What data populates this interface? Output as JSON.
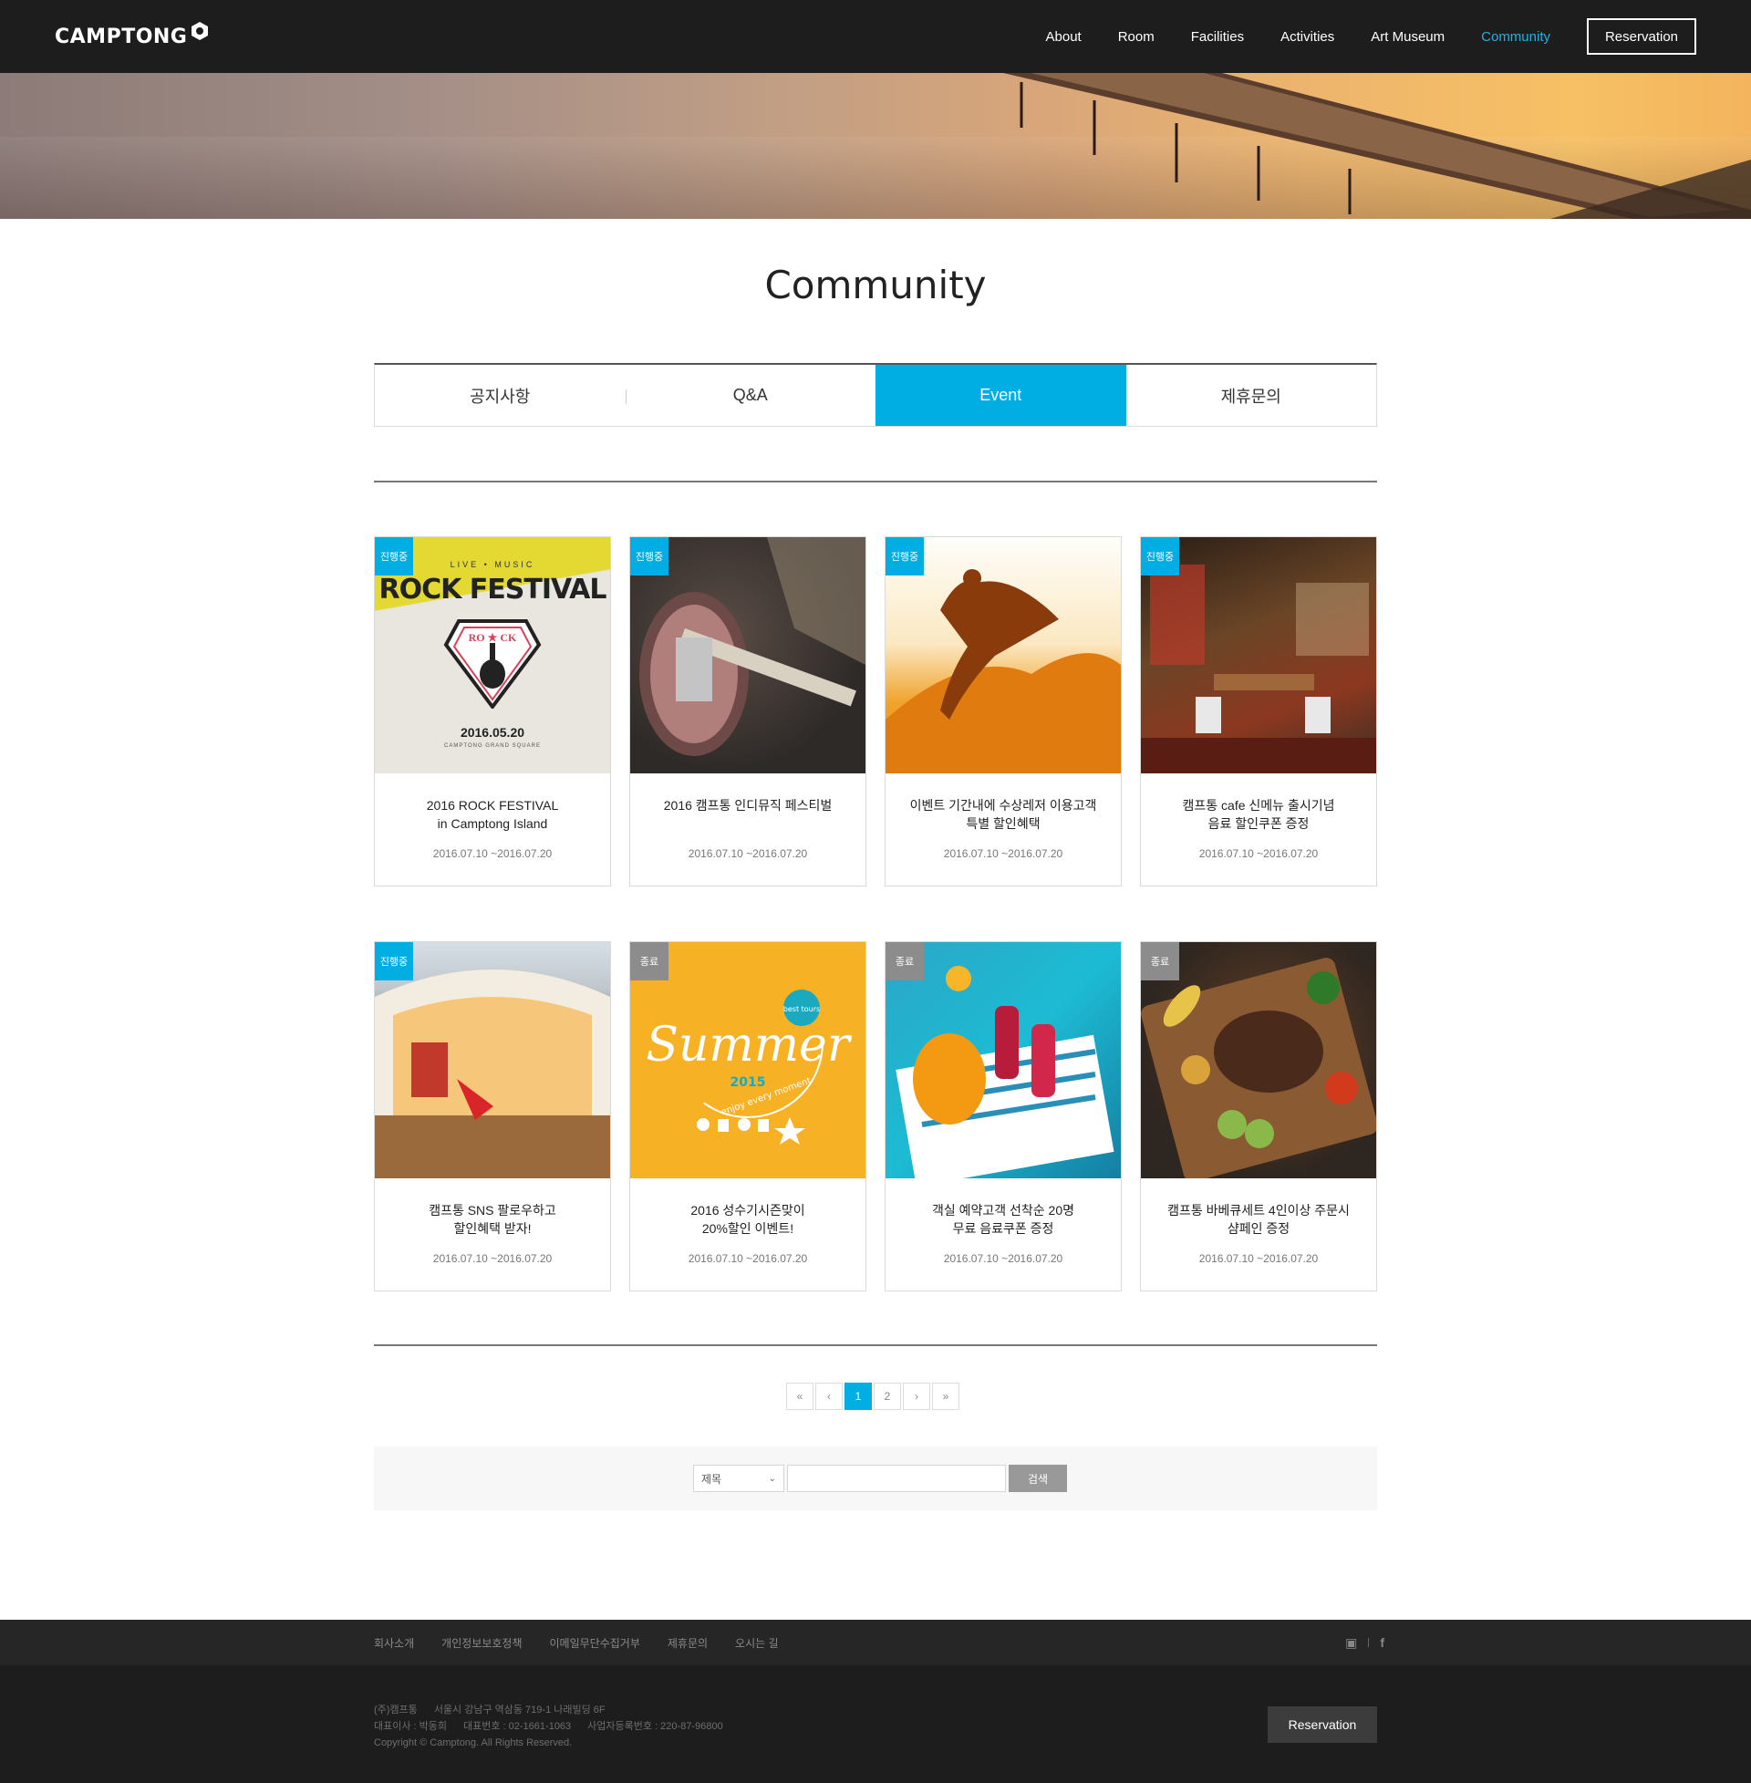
{
  "header": {
    "logo": "CAMPTONG",
    "nav": [
      "About",
      "Room",
      "Facilities",
      "Activities",
      "Art Museum",
      "Community"
    ],
    "active_nav": "Community",
    "reservation": "Reservation"
  },
  "page_title": "Community",
  "tabs": [
    "공지사항",
    "Q&A",
    "Event",
    "제휴문의"
  ],
  "active_tab": "Event",
  "poster": {
    "live": "LIVE • MUSIC",
    "headline": "ROCK FESTIVAL",
    "date": "2016.05.20",
    "place": "CAMPTONG GRAND SQUARE"
  },
  "summer_poster": {
    "word": "Summer",
    "year": "2015",
    "tagline": "enjoy every moment",
    "seal": "best tours"
  },
  "events": [
    {
      "status": "진행중",
      "state": "on",
      "title1": "2016 ROCK FESTIVAL",
      "title2": "in Camptong Island",
      "date": "2016.07.10 ~2016.07.20"
    },
    {
      "status": "진행중",
      "state": "on",
      "title1": "2016 캠프통 인디뮤직 페스티벌",
      "title2": "",
      "date": "2016.07.10 ~2016.07.20"
    },
    {
      "status": "진행중",
      "state": "on",
      "title1": "이벤트 기간내에 수상레저 이용고객",
      "title2": "특별 할인혜택",
      "date": "2016.07.10 ~2016.07.20"
    },
    {
      "status": "진행중",
      "state": "on",
      "title1": "캠프통 cafe 신메뉴 출시기념",
      "title2": "음료 할인쿠폰 증정",
      "date": "2016.07.10 ~2016.07.20"
    },
    {
      "status": "진행중",
      "state": "on",
      "title1": "캠프통 SNS 팔로우하고",
      "title2": "할인혜택 받자!",
      "date": "2016.07.10 ~2016.07.20"
    },
    {
      "status": "종료",
      "state": "off",
      "title1": "2016 성수기시즌맞이",
      "title2": "20%할인 이벤트!",
      "date": "2016.07.10 ~2016.07.20"
    },
    {
      "status": "종료",
      "state": "off",
      "title1": "객실 예약고객 선착순 20명",
      "title2": "무료 음료쿠폰 증정",
      "date": "2016.07.10 ~2016.07.20"
    },
    {
      "status": "종료",
      "state": "off",
      "title1": "캠프통 바베큐세트 4인이상 주문시",
      "title2": "샴페인 증정",
      "date": "2016.07.10 ~2016.07.20"
    }
  ],
  "pagination": {
    "pages": [
      "1",
      "2"
    ],
    "current": "1"
  },
  "search": {
    "field": "제목",
    "value": "",
    "button": "검색"
  },
  "footer": {
    "links": [
      "회사소개",
      "개인정보보호정책",
      "이메일무단수집거부",
      "제휴문의",
      "오시는 길"
    ],
    "company": "(주)캠프통",
    "address": "서울시 강남구 역삼동 719-1 나래빌딩 6F",
    "ceo": "대표이사 : 박동희",
    "phone": "대표번호 : 02-1661-1063",
    "biz": "사업자등록번호 : 220-87-96800",
    "copyright": "Copyright © Camptong. All Rights Reserved.",
    "reservation": "Reservation"
  },
  "colors": {
    "accent": "#01aee4",
    "header_bg": "#1d1d1d",
    "ended": "#8c8c8c"
  }
}
